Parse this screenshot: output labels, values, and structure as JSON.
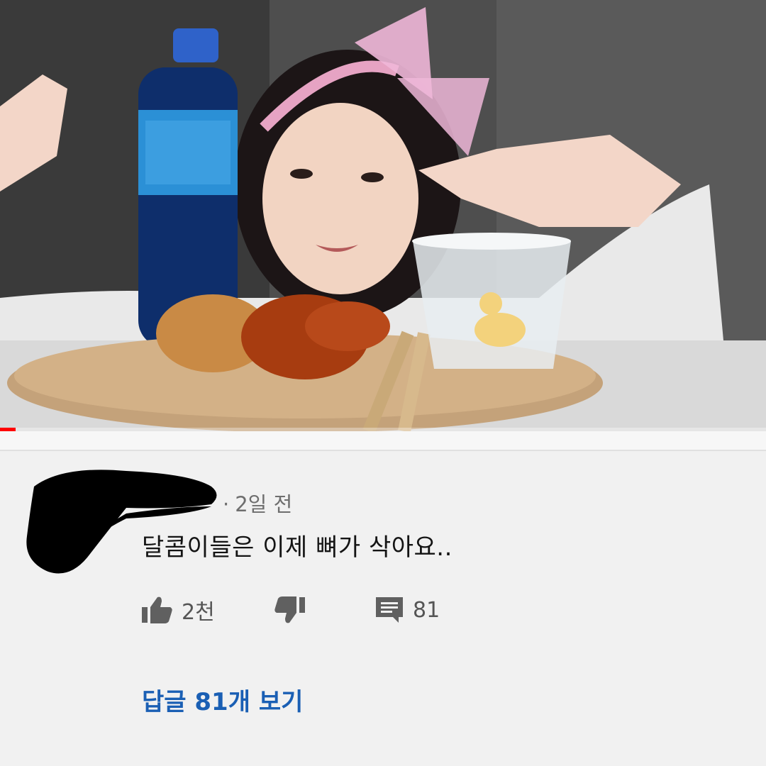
{
  "video": {
    "thumbnail_icon": "video-frame",
    "progress_percent": 2
  },
  "comment": {
    "author_hidden": true,
    "time_ago": "2일 전",
    "text": "달콤이들은 이제 뼈가 삭아요..",
    "likes": "2천",
    "reply_count": "81",
    "view_replies_label": "답글 81개 보기"
  },
  "colors": {
    "link": "#1a5fb4",
    "progress": "#ff0000"
  },
  "icons": {
    "like": "thumbs-up-icon",
    "dislike": "thumbs-down-icon",
    "reply": "comment-icon"
  }
}
